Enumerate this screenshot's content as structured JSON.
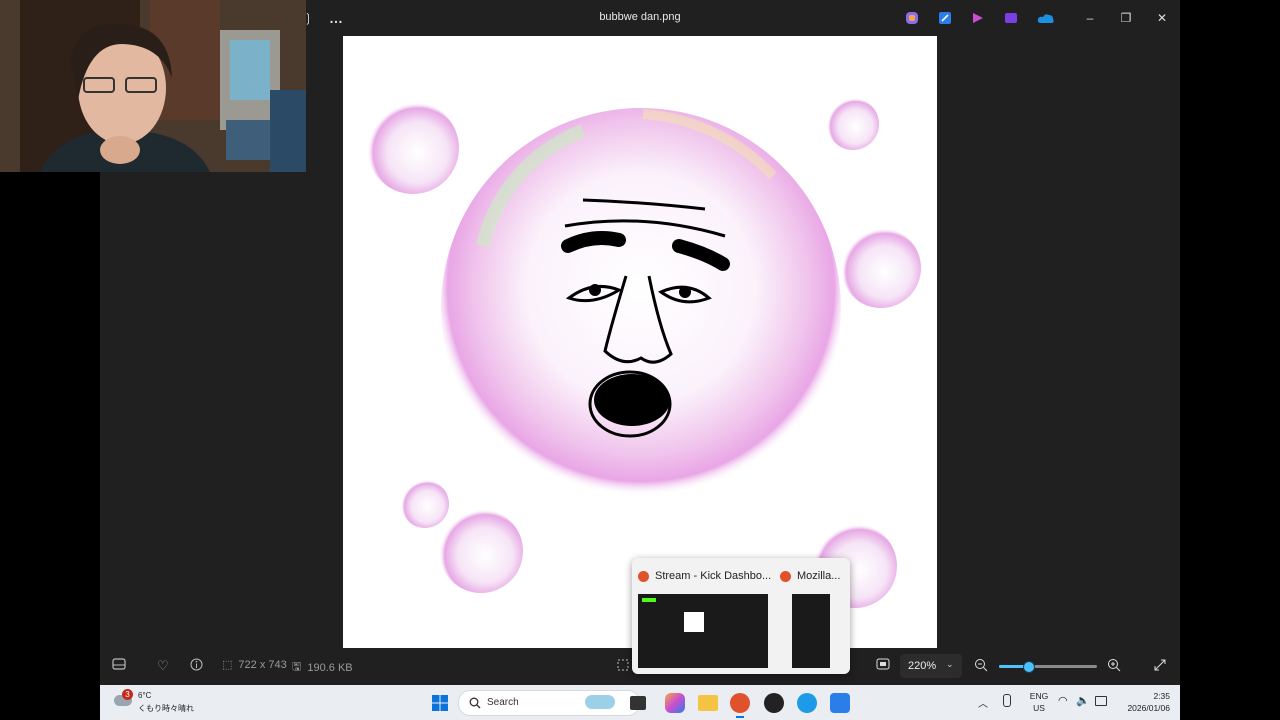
{
  "window": {
    "title": "bubbwe dan.png",
    "more_label": "…",
    "minimize_glyph": "–",
    "restore_glyph": "❐",
    "close_glyph": "✕"
  },
  "image_info": {
    "dimensions": "722 x 743",
    "file_size": "190.6 KB"
  },
  "zoom": {
    "level": "220%",
    "slider_fraction": 0.3
  },
  "taskbar": {
    "weather_temp": "6°C",
    "weather_desc": "くもり時々晴れ",
    "weather_badge": "3",
    "search_placeholder": "Search",
    "lang_primary": "ENG",
    "lang_secondary": "US",
    "time": "2:35",
    "date": "2026/01/06"
  },
  "preview": {
    "items": [
      {
        "label": "Stream - Kick Dashbo..."
      },
      {
        "label": "Mozilla..."
      }
    ]
  },
  "colors": {
    "accent": "#4cc2ff",
    "app_bg": "#202020",
    "taskbar_bg": "#eaeef3"
  }
}
